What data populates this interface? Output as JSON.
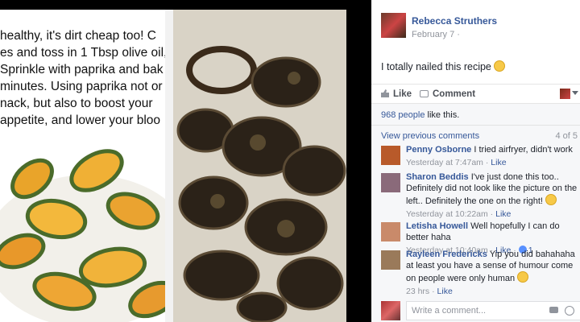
{
  "caption_lines": [
    "healthy, it's dirt cheap too! C",
    "es and toss in 1 Tbsp olive oil,",
    "Sprinkle with paprika and bak",
    "minutes. Using paprika not or",
    "nack, but also to boost your",
    "appetite, and lower your bloo"
  ],
  "post": {
    "author": "Rebecca Struthers",
    "date": "February 7 ·",
    "text": "I totally nailed this recipe",
    "like_label": "Like",
    "comment_label": "Comment"
  },
  "feedback": {
    "likes_count": "968 people",
    "likes_suffix": " like this.",
    "view_previous": "View previous comments",
    "count": "4 of 5"
  },
  "comments": [
    {
      "name": "Penny Osborne",
      "text": "I tried airfryer, didn't work",
      "time": "Yesterday at 7:47am",
      "action": "Like",
      "avatar_color": "#b85a2a"
    },
    {
      "name": "Sharon Beddis",
      "text": "I've just done this too.. Definitely did not look like the picture on the left.. Definitely the one on the right!",
      "time": "Yesterday at 10:22am",
      "action": "Like",
      "avatar_color": "#8a6a7a"
    },
    {
      "name": "Letisha Howell",
      "text": "Well hopefully I can do better haha",
      "time": "Yesterday at 10:40am",
      "action": "Like",
      "reactions": "1",
      "avatar_color": "#c98a6a"
    },
    {
      "name": "Rayleen Fredericks",
      "text": "Yip you did bahahaha at least you have a sense of humour come on people were only human",
      "time": "23 hrs",
      "action": "Like",
      "avatar_color": "#9a7a5a"
    }
  ],
  "composer": {
    "placeholder": "Write a comment..."
  },
  "colors": {
    "link": "#365899",
    "meta": "#90949c",
    "feedback_bg": "#f6f7f9"
  }
}
